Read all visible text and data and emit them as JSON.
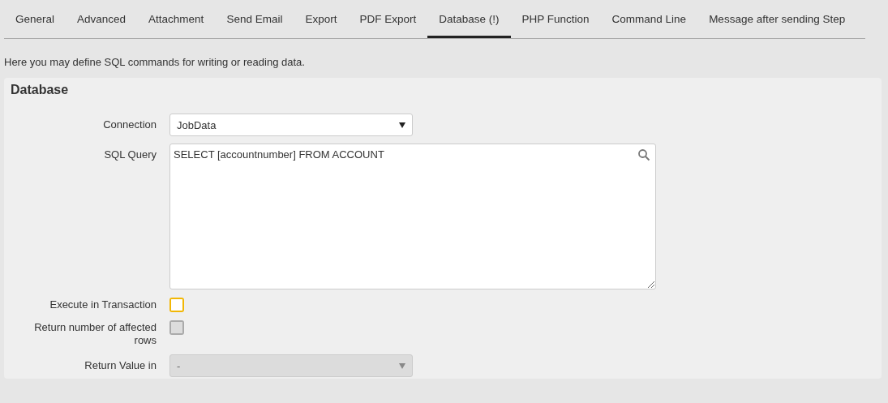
{
  "tabs": [
    {
      "label": "General",
      "selected": false
    },
    {
      "label": "Advanced",
      "selected": false
    },
    {
      "label": "Attachment",
      "selected": false
    },
    {
      "label": "Send Email",
      "selected": false
    },
    {
      "label": "Export",
      "selected": false
    },
    {
      "label": "PDF Export",
      "selected": false
    },
    {
      "label": "Database (!)",
      "selected": true
    },
    {
      "label": "PHP Function",
      "selected": false
    },
    {
      "label": "Command Line",
      "selected": false
    },
    {
      "label": "Message after sending Step",
      "selected": false
    }
  ],
  "description": "Here you may define SQL commands for writing or reading data.",
  "panel": {
    "title": "Database",
    "fields": [
      {
        "kind": "select",
        "label": "Connection",
        "value": "JobData",
        "disabled": false
      },
      {
        "kind": "textarea",
        "label": "SQL Query",
        "value": "SELECT [accountnumber] FROM ACCOUNT"
      },
      {
        "kind": "checkbox",
        "label": "Execute in Transaction",
        "checked": false,
        "color": "#f2b705",
        "disabled": false
      },
      {
        "kind": "checkbox",
        "label": "Return number of affected rows",
        "checked": false,
        "color": "#aaaaaa",
        "disabled": true
      },
      {
        "kind": "select",
        "label": "Return Value in",
        "value": "-",
        "disabled": true
      }
    ]
  }
}
